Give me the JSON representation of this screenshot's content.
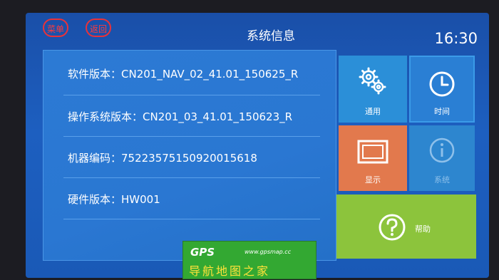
{
  "header": {
    "menu_label": "菜单",
    "back_label": "返回",
    "title": "系统信息",
    "time": "16:30"
  },
  "info": {
    "rows": [
      {
        "text": "软件版本：CN201_NAV_02_41.01_150625_R"
      },
      {
        "text": "操作系统版本：CN201_03_41.01_150623_R"
      },
      {
        "text": "机器编码：75223575150920015618"
      },
      {
        "text": "硬件版本：HW001"
      }
    ]
  },
  "tiles": {
    "general": {
      "label": "通用",
      "icon": "gear-icon"
    },
    "time": {
      "label": "时间",
      "icon": "clock-icon"
    },
    "display": {
      "label": "显示",
      "icon": "display-icon"
    },
    "system": {
      "label": "系统",
      "icon": "info-icon"
    },
    "help": {
      "label": "帮助",
      "icon": "help-icon"
    }
  },
  "watermark": {
    "logo": "GPS",
    "url": "www.gpsmap.cc",
    "text": "导航地图之家"
  },
  "colors": {
    "screen_bg": "#1d5fc0",
    "panel_bg": "#2a77d2",
    "general_tile": "#2b8fd8",
    "display_tile": "#e2794d",
    "help_tile": "#8cc43c",
    "header_button": "#e8323a"
  }
}
